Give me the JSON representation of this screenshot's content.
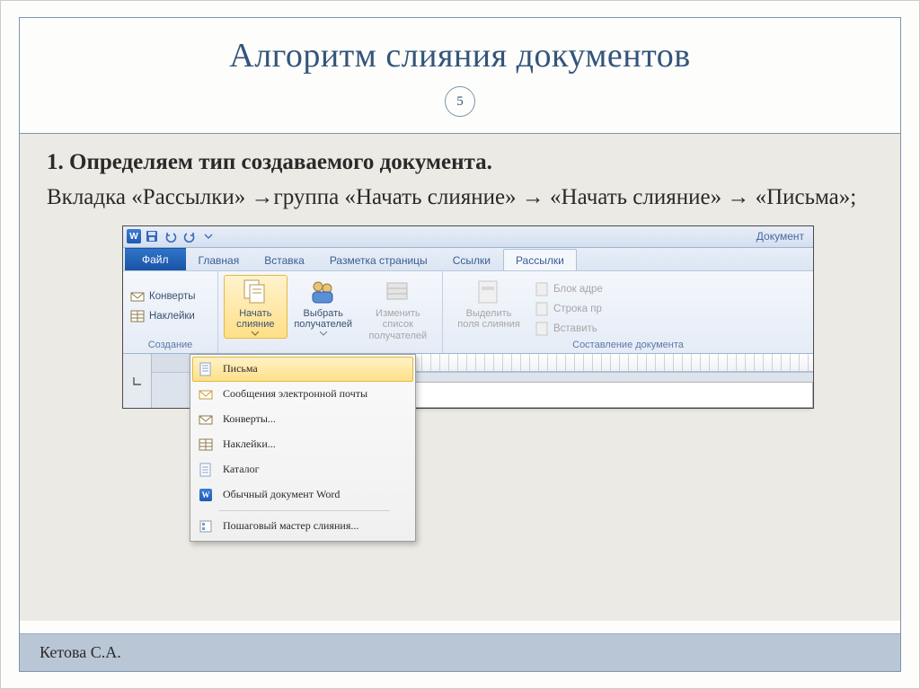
{
  "slide": {
    "title": "Алгоритм слияния документов",
    "number": "5",
    "step_title": "1. Определяем тип создаваемого документа.",
    "step_text": "Вкладка «Рассылки» →группа «Начать слияние» → «Начать слияние» → «Письма»;",
    "footer_author": "Кетова С.А."
  },
  "word": {
    "doc_title": "Документ",
    "tabs": {
      "file": "Файл",
      "home": "Главная",
      "insert": "Вставка",
      "layout": "Разметка страницы",
      "refs": "Ссылки",
      "mailings": "Рассылки"
    },
    "groups": {
      "create": {
        "label": "Создание",
        "envelopes": "Конверты",
        "labels": "Наклейки"
      },
      "start": {
        "start_merge": "Начать слияние",
        "select_recip": "Выбрать получателей",
        "edit_recip": "Изменить список получателей"
      },
      "compose": {
        "label": "Составление документа",
        "highlight": "Выделить поля слияния",
        "addr_block": "Блок адре",
        "greeting": "Строка пр",
        "insert_field": "Вставить"
      }
    },
    "dropdown": {
      "letters": "Письма",
      "email": "Сообщения электронной почты",
      "envelopes": "Конверты...",
      "labels": "Наклейки...",
      "catalog": "Каталог",
      "normal": "Обычный документ Word",
      "wizard": "Пошаговый мастер слияния..."
    }
  }
}
